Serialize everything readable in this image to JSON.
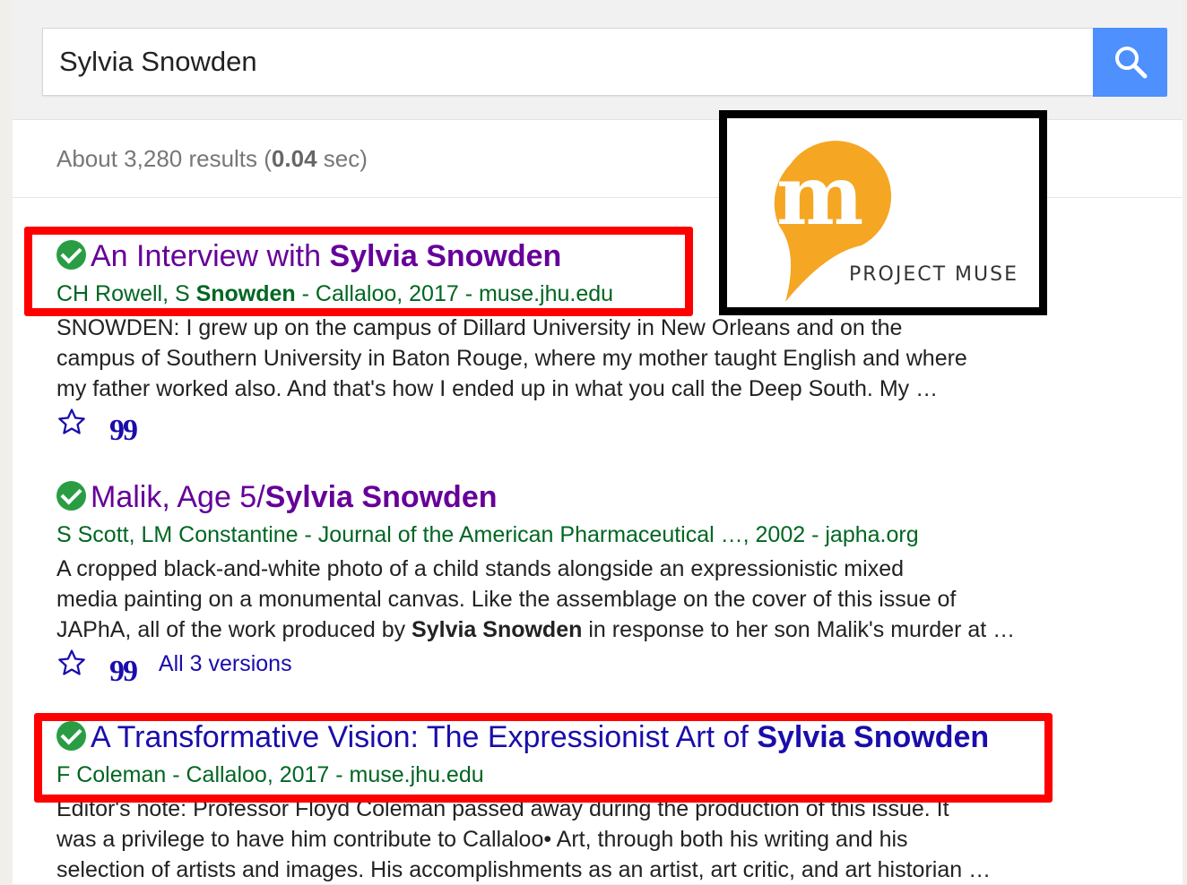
{
  "search": {
    "query": "Sylvia Snowden"
  },
  "stats": {
    "prefix": "About 3,280 results (",
    "time": "0.04",
    "suffix": " sec)"
  },
  "logo": {
    "text": "PROJECT MUSE",
    "color": "#f5a623"
  },
  "colors": {
    "visited": "#660099",
    "link": "#1a0dab",
    "meta": "#006621",
    "highlight": "#ff0000",
    "accent": "#4d90fe"
  },
  "results": [
    {
      "title_pre": "An Interview with ",
      "title_bold": "Sylvia Snowden",
      "meta_pre": "CH Rowell, S ",
      "meta_bold": "Snowden",
      "meta_post": " - Callaloo, 2017 - muse.jhu.edu",
      "snippet": [
        "SNOWDEN: I grew up on the campus of Dillard University in New Orleans and on the",
        "campus of Southern University in Baton Rouge, where my mother taught English and where",
        "my father worked also. And that's how I ended up in what you call the Deep South. My …"
      ]
    },
    {
      "title_pre": "Malik, Age 5/",
      "title_bold": "Sylvia Snowden",
      "meta": "S Scott, LM Constantine - Journal of the American Pharmaceutical …, 2002 - japha.org",
      "snippet": [
        "A cropped black-and-white photo of a child stands alongside an expressionistic mixed",
        "media painting on a monumental canvas. Like the assemblage on the cover of this issue of"
      ],
      "snippet_line3_pre": "JAPhA, all of the work produced by ",
      "snippet_line3_bold": "Sylvia Snowden",
      "snippet_line3_post": " in response to her son Malik's murder at …",
      "versions": "All 3 versions"
    },
    {
      "title_pre": "A Transformative Vision: The Expressionist Art of ",
      "title_bold": "Sylvia Snowden",
      "meta": "F Coleman - Callaloo, 2017 - muse.jhu.edu",
      "snippet": [
        "Editor's note: Professor Floyd Coleman passed away during the production of this issue. It",
        "was a privilege to have him contribute to Callaloo• Art, through both his writing and his",
        "selection of artists and images. His accomplishments as an artist, art critic, and art historian …"
      ]
    }
  ],
  "icons": {
    "cite": "99"
  }
}
